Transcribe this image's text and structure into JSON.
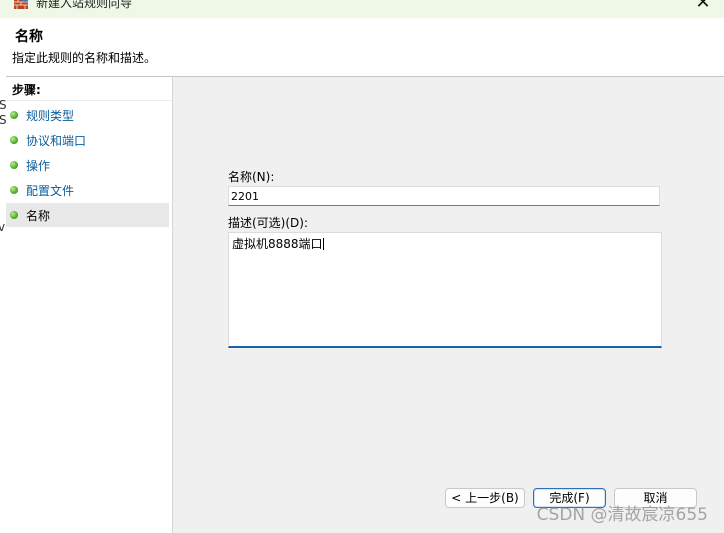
{
  "window": {
    "title": "新建入站规则向导",
    "close_glyph": "✕"
  },
  "header": {
    "title": "名称",
    "subtitle": "指定此规则的名称和描述。"
  },
  "left_fragments": [
    "S",
    "S",
    "v"
  ],
  "steps": {
    "heading": "步骤:",
    "items": [
      {
        "label": "规则类型"
      },
      {
        "label": "协议和端口"
      },
      {
        "label": "操作"
      },
      {
        "label": "配置文件"
      },
      {
        "label": "名称",
        "selected": true
      }
    ]
  },
  "form": {
    "name_label": "名称(N):",
    "name_value": "2201",
    "desc_label": "描述(可选)(D):",
    "desc_value": "虚拟机8888端口"
  },
  "buttons": {
    "back": "< 上一步(B)",
    "finish": "完成(F)",
    "cancel": "取消"
  },
  "watermark": "CSDN @清故宸凉655",
  "colors": {
    "step_link": "#0a5c9c",
    "focus_border": "#1b5fa5",
    "titlebar_bg": "#eff8e6"
  }
}
